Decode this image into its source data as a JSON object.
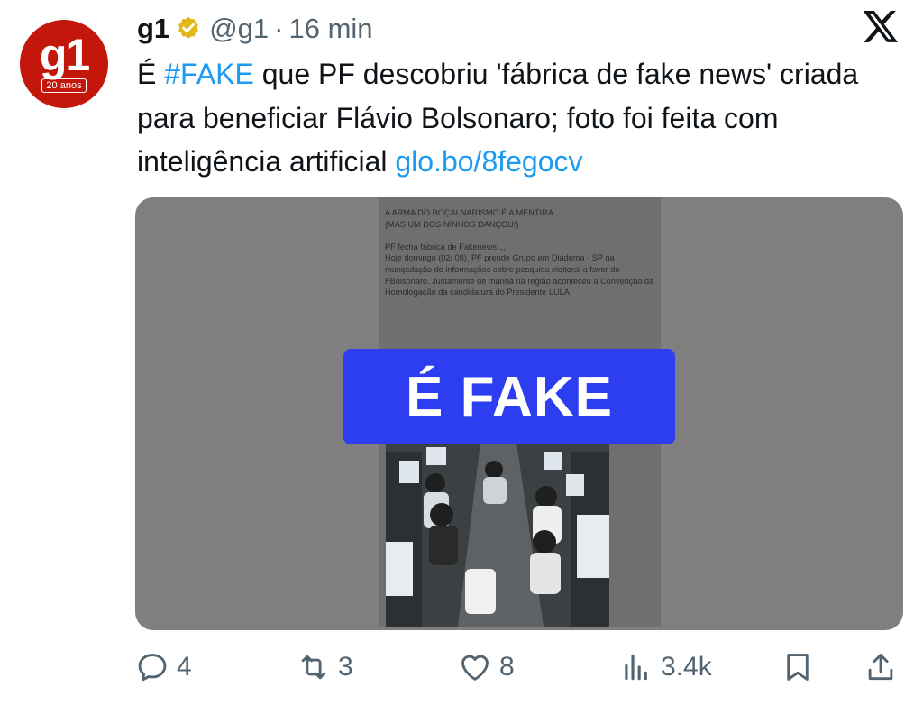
{
  "tweet": {
    "avatar": {
      "main": "g1",
      "sub": "20 anos",
      "color": "#c4170c"
    },
    "author_name": "g1",
    "handle": "@g1",
    "separator": "·",
    "time": "16 min",
    "text": {
      "prefix": "É ",
      "hashtag": "#FAKE",
      "body": " que PF descobriu 'fábrica de fake news' criada para beneficiar Flávio Bolsonaro; foto foi feita com inteligência artificial ",
      "link": "glo.bo/8fegocv"
    },
    "media": {
      "doc_text": "A ARMA DO BOÇALNARISMO É A MENTIRA...\n(MAS UM DOS NINHOS DANÇOU!)\n\nPF fecha fábrica de Fakenews...,\nHoje domingo (02/ 08), PF prende Grupo em Diadema - SP na\nmanipulação de informações sobre pesquisa eleitoral a favor do\nFBolsonaro. Justamente de manhã na região aconteceu a Convenção da\nHomologação da candidatura do Presidente LULA.",
      "badge_text": "É FAKE",
      "badge_color": "#2d3df0"
    },
    "actions": {
      "replies": "4",
      "reposts": "3",
      "likes": "8",
      "views": "3.4k"
    },
    "icons": [
      "verified-badge-icon",
      "x-logo-icon",
      "reply-icon",
      "repost-icon",
      "like-icon",
      "views-icon",
      "bookmark-icon",
      "share-icon"
    ],
    "accent_color": "#1d9bf0"
  }
}
